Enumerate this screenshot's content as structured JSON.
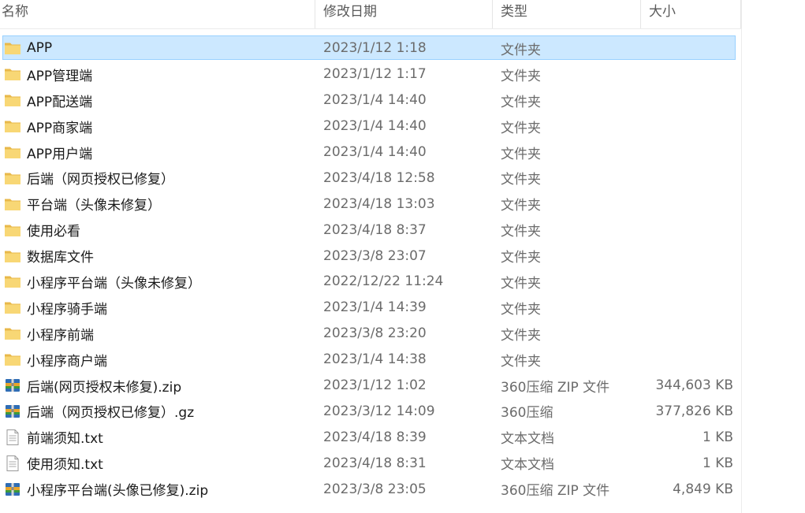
{
  "columns": {
    "name": "名称",
    "date": "修改日期",
    "type": "类型",
    "size": "大小"
  },
  "colors": {
    "selection": "#cce8ff",
    "selection_border": "#99d1ff",
    "folder": "#f8d775"
  },
  "files": [
    {
      "name": "APP",
      "date": "2023/1/12 1:18",
      "type": "文件夹",
      "size": "",
      "icon": "folder-icon",
      "selected": true
    },
    {
      "name": "APP管理端",
      "date": "2023/1/12 1:17",
      "type": "文件夹",
      "size": "",
      "icon": "folder-icon"
    },
    {
      "name": "APP配送端",
      "date": "2023/1/4 14:40",
      "type": "文件夹",
      "size": "",
      "icon": "folder-icon"
    },
    {
      "name": "APP商家端",
      "date": "2023/1/4 14:40",
      "type": "文件夹",
      "size": "",
      "icon": "folder-icon"
    },
    {
      "name": "APP用户端",
      "date": "2023/1/4 14:40",
      "type": "文件夹",
      "size": "",
      "icon": "folder-icon"
    },
    {
      "name": "后端（网页授权已修复）",
      "date": "2023/4/18 12:58",
      "type": "文件夹",
      "size": "",
      "icon": "folder-icon"
    },
    {
      "name": "平台端（头像未修复）",
      "date": "2023/4/18 13:03",
      "type": "文件夹",
      "size": "",
      "icon": "folder-icon"
    },
    {
      "name": "使用必看",
      "date": "2023/4/18 8:37",
      "type": "文件夹",
      "size": "",
      "icon": "folder-icon"
    },
    {
      "name": "数据库文件",
      "date": "2023/3/8 23:07",
      "type": "文件夹",
      "size": "",
      "icon": "folder-icon"
    },
    {
      "name": "小程序平台端（头像未修复）",
      "date": "2022/12/22 11:24",
      "type": "文件夹",
      "size": "",
      "icon": "folder-icon"
    },
    {
      "name": "小程序骑手端",
      "date": "2023/1/4 14:39",
      "type": "文件夹",
      "size": "",
      "icon": "folder-icon"
    },
    {
      "name": "小程序前端",
      "date": "2023/3/8 23:20",
      "type": "文件夹",
      "size": "",
      "icon": "folder-icon"
    },
    {
      "name": "小程序商户端",
      "date": "2023/1/4 14:38",
      "type": "文件夹",
      "size": "",
      "icon": "folder-icon"
    },
    {
      "name": "后端(网页授权未修复).zip",
      "date": "2023/1/12 1:02",
      "type": "360压缩 ZIP 文件",
      "size": "344,603 KB",
      "icon": "archive-icon"
    },
    {
      "name": "后端（网页授权已修复）.gz",
      "date": "2023/3/12 14:09",
      "type": "360压缩",
      "size": "377,826 KB",
      "icon": "archive-icon"
    },
    {
      "name": "前端须知.txt",
      "date": "2023/4/18 8:39",
      "type": "文本文档",
      "size": "1 KB",
      "icon": "text-file-icon"
    },
    {
      "name": "使用须知.txt",
      "date": "2023/4/18 8:31",
      "type": "文本文档",
      "size": "1 KB",
      "icon": "text-file-icon"
    },
    {
      "name": "小程序平台端(头像已修复).zip",
      "date": "2023/3/8 23:05",
      "type": "360压缩 ZIP 文件",
      "size": "4,849 KB",
      "icon": "archive-icon"
    }
  ]
}
